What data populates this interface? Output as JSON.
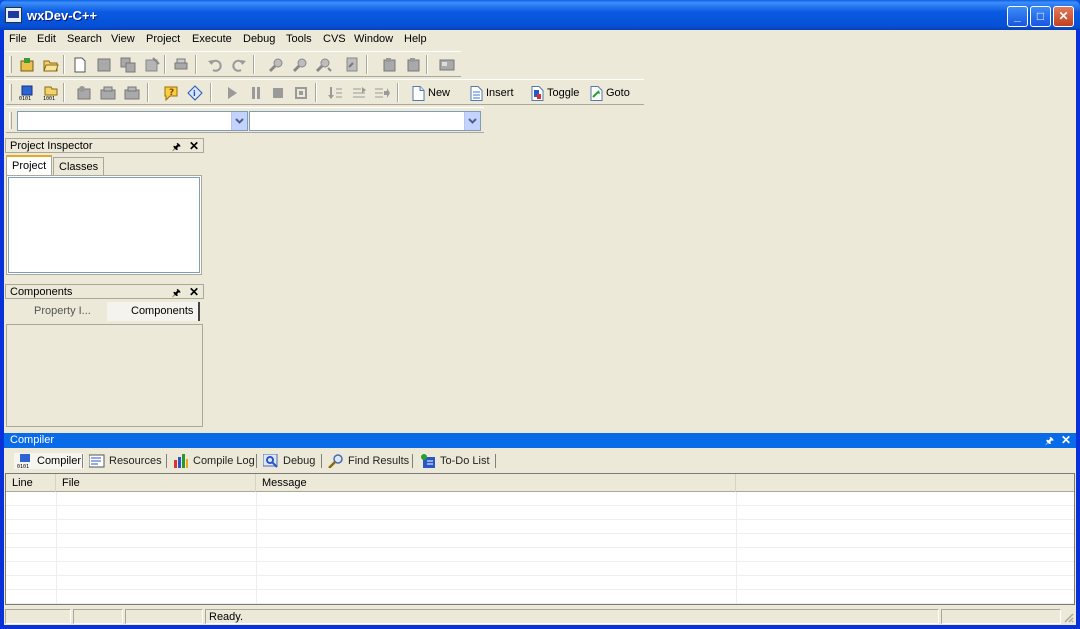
{
  "window": {
    "title": "wxDev-C++",
    "minimize": "_",
    "maximize": "□",
    "close": "✕"
  },
  "menu": [
    "File",
    "Edit",
    "Search",
    "View",
    "Project",
    "Execute",
    "Debug",
    "Tools",
    "CVS",
    "Window",
    "Help"
  ],
  "toolbar2": {
    "new_label": "New",
    "insert_label": "Insert",
    "toggle_label": "Toggle",
    "goto_label": "Goto"
  },
  "combos": {
    "class_value": "",
    "member_value": ""
  },
  "project_inspector": {
    "title": "Project Inspector",
    "tabs": [
      "Project",
      "Classes"
    ]
  },
  "components_panel": {
    "title": "Components",
    "tabs": [
      "Property I...",
      "Components"
    ]
  },
  "compiler_panel": {
    "title": "Compiler",
    "tabs": [
      "Compiler",
      "Resources",
      "Compile Log",
      "Debug",
      "Find Results",
      "To-Do List"
    ],
    "columns": [
      "Line",
      "File",
      "Message"
    ]
  },
  "status": {
    "text": "Ready."
  },
  "colors": {
    "xp_blue": "#0a5ae3",
    "panel_bg": "#ece9d8",
    "active_header": "#0a6be8"
  },
  "icons": [
    "app-icon",
    "new-project-icon",
    "open-icon",
    "new-file-icon",
    "save-icon",
    "save-all-icon",
    "close-file-icon",
    "print-icon",
    "undo-icon",
    "redo-icon",
    "find-icon",
    "replace-icon",
    "find-next-icon",
    "goto-line-icon",
    "add-to-project-icon",
    "remove-from-project-icon",
    "project-options-icon",
    "compile-icon",
    "compile-run-icon",
    "run-icon",
    "rebuild-icon",
    "help-icon",
    "about-icon",
    "debug-run-icon",
    "pause-icon",
    "stop-icon",
    "step-icon",
    "step-over-icon",
    "step-into-icon",
    "step-out-icon",
    "bookmark-icon"
  ]
}
